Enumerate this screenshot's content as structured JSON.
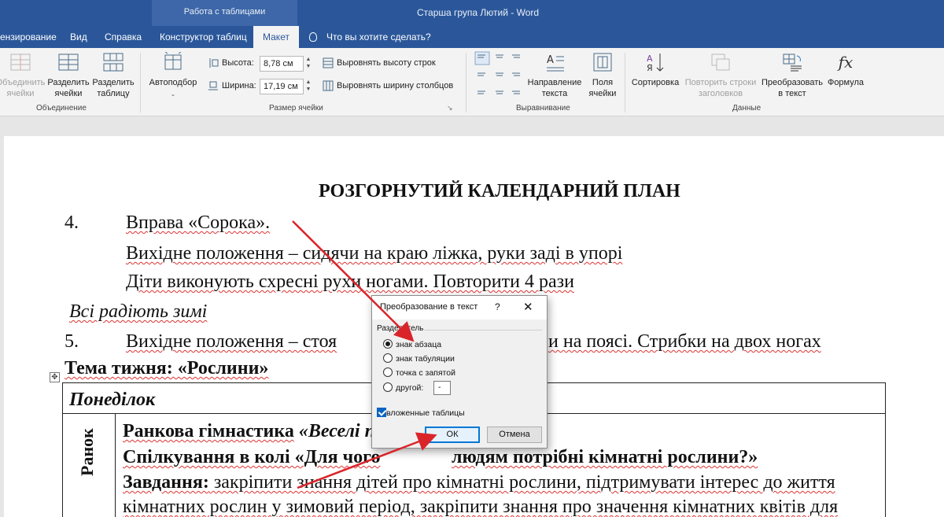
{
  "titlebar": {
    "context_label": "Работа с таблицами",
    "doc_title": "Старша група Лютий  -  Word",
    "tabs": [
      "ензирование",
      "Вид",
      "Справка",
      "Конструктор таблиц",
      "Макет"
    ],
    "active_tab": "Макет",
    "tell_me": "Что вы хотите сделать?"
  },
  "ribbon": {
    "merge": {
      "buttons": [
        {
          "line1": "Объединить",
          "line2": "ячейки",
          "disabled": true
        },
        {
          "line1": "Разделить",
          "line2": "ячейки",
          "disabled": false
        },
        {
          "line1": "Разделить",
          "line2": "таблицу",
          "disabled": false
        }
      ],
      "group_label": "Объединение"
    },
    "cell_size": {
      "autofit": "Автоподбор",
      "height_label": "Высота:",
      "height_value": "8,78 см",
      "width_label": "Ширина:",
      "width_value": "17,19 см",
      "distribute_rows": "Выровнять высоту строк",
      "distribute_cols": "Выровнять ширину столбцов",
      "group_label": "Размер ячейки"
    },
    "alignment": {
      "text_direction_1": "Направление",
      "text_direction_2": "текста",
      "margins_1": "Поля",
      "margins_2": "ячейки",
      "group_label": "Выравнивание"
    },
    "data": {
      "sort": "Сортировка",
      "repeat_1": "Повторить строки",
      "repeat_2": "заголовков",
      "convert_1": "Преобразовать",
      "convert_2": "в текст",
      "formula": "Формула",
      "formula_glyph": "fx",
      "group_label": "Данные"
    }
  },
  "document": {
    "heading": "РОЗГОРНУТИЙ КАЛЕНДАРНИЙ ПЛАН",
    "line_4_num": "4.",
    "line_4_text": "Вправа «Сорока».",
    "line_4b": "Вихідне положення – сидячи на краю ліжка, руки заді в упорі",
    "line_4c": "Діти виконують схресні рухи ногами. Повторити 4 рази",
    "italic_line": "Всі радіють зимі",
    "line_5_num": "5.",
    "line_5_left": "Вихідне положення – стоя",
    "line_5_right": "и на поясі. Стрибки на двох ногах",
    "theme": "Тема тижня: «Рослини»",
    "monday": "Понеділок",
    "row_label": "Ранок",
    "row1_bold": "Ранкова гімнастика",
    "row1_italic": "«Веселі п",
    "row2_left": "Спілкування в колі «Для чого",
    "row2_right": "людям потрібні кімнатні рослини?»",
    "row3_label": "Завдання:",
    "row3_text": " закріпити знання дітей про кімнатні рослини, підтримувати інтерес до життя",
    "row4_text": "кімнатних рослин у зимовий період, закріпити знання про значення кімнатних квітів для"
  },
  "dialog": {
    "title": "Преобразование в текст",
    "help": "?",
    "close": "✕",
    "group_label": "Разделитель",
    "options": [
      {
        "label": "знак абзаца",
        "selected": true
      },
      {
        "label": "знак табуляции",
        "selected": false
      },
      {
        "label": "точка с запятой",
        "selected": false
      },
      {
        "label": "другой:",
        "selected": false
      }
    ],
    "other_value": "-",
    "nested_label": "вложенные таблицы",
    "nested_checked": true,
    "ok": "ОК",
    "cancel": "Отмена"
  },
  "colors": {
    "titlebar": "#2b579a",
    "annotation_arrow": "#d9252a",
    "ok_border": "#0078d7"
  }
}
